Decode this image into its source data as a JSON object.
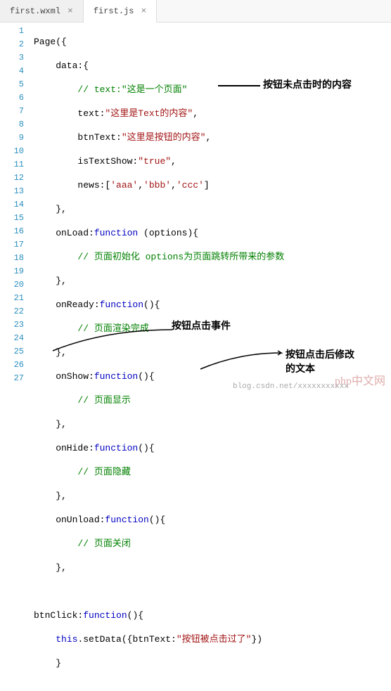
{
  "tabs": [
    {
      "label": "first.wxml",
      "active": false
    },
    {
      "label": "first.js",
      "active": true
    }
  ],
  "lines": {
    "l1": {
      "t1": "Page({"
    },
    "l2": {
      "t1": "    data:{"
    },
    "l3": {
      "t1": "        ",
      "c1": "// text:\"这是一个页面\""
    },
    "l4": {
      "t1": "        text:",
      "s1": "\"这里是Text的内容\"",
      "t2": ","
    },
    "l5": {
      "t1": "        btnText:",
      "s1": "\"这里是按钮的内容\"",
      "t2": ","
    },
    "l6": {
      "t1": "        isTextShow:",
      "s1": "\"true\"",
      "t2": ","
    },
    "l7": {
      "t1": "        news:[",
      "s1": "'aaa'",
      "t2": ",",
      "s2": "'bbb'",
      "t3": ",",
      "s3": "'ccc'",
      "t4": "]"
    },
    "l8": {
      "t1": "    },"
    },
    "l9": {
      "t1": "    onLoad:",
      "k1": "function",
      "t2": " (options){"
    },
    "l10": {
      "t1": "        ",
      "c1": "// 页面初始化 options为页面跳转所带来的参数"
    },
    "l11": {
      "t1": "    },"
    },
    "l12": {
      "t1": "    onReady:",
      "k1": "function",
      "t2": "(){"
    },
    "l13": {
      "t1": "        ",
      "c1": "// 页面渲染完成"
    },
    "l14": {
      "t1": "    },"
    },
    "l15": {
      "t1": "    onShow:",
      "k1": "function",
      "t2": "(){"
    },
    "l16": {
      "t1": "        ",
      "c1": "// 页面显示"
    },
    "l17": {
      "t1": "    },"
    },
    "l18": {
      "t1": "    onHide:",
      "k1": "function",
      "t2": "(){"
    },
    "l19": {
      "t1": "        ",
      "c1": "// 页面隐藏"
    },
    "l20": {
      "t1": "    },"
    },
    "l21": {
      "t1": "    onUnload:",
      "k1": "function",
      "t2": "(){"
    },
    "l22": {
      "t1": "        ",
      "c1": "// 页面关闭"
    },
    "l23": {
      "t1": "    },"
    },
    "l24": {
      "t1": ""
    },
    "l25": {
      "t1": "btnClick:",
      "k1": "function",
      "t2": "(){"
    },
    "l26": {
      "t1": "    ",
      "k1": "this",
      "t2": ".setData({btnText:",
      "s1": "\"按钮被点击过了\"",
      "t3": "})"
    },
    "l27": {
      "t1": "    }"
    }
  },
  "annotations": {
    "a1": "按钮未点击时的内容",
    "a2": "按钮点击事件",
    "a3": "按钮点击后修改",
    "a3b": "的文本"
  },
  "watermark": "php中文网",
  "watermark2": "blog.csdn.net/xxxxxxxxxxx"
}
